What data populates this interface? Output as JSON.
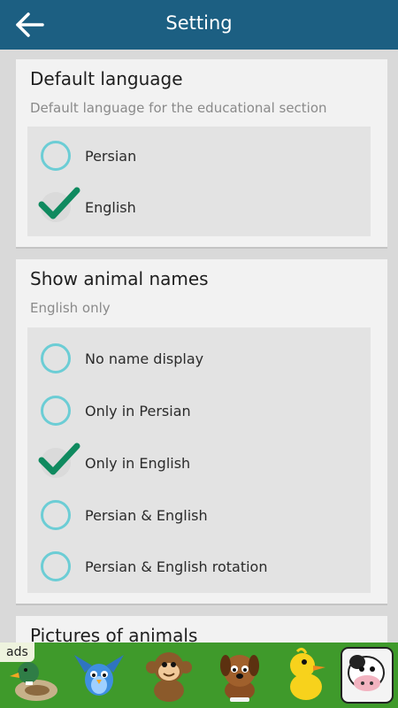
{
  "appbar": {
    "title": "Setting",
    "back_icon": "arrow-back-icon"
  },
  "language_section": {
    "title": "Default language",
    "subtitle": "Default language for the educational section",
    "options": [
      {
        "label": "Persian",
        "selected": false
      },
      {
        "label": "English",
        "selected": true
      }
    ]
  },
  "names_section": {
    "title": "Show animal names",
    "subtitle": "English only",
    "options": [
      {
        "label": "No name display",
        "selected": false
      },
      {
        "label": "Only in Persian",
        "selected": false
      },
      {
        "label": "Only in English",
        "selected": true
      },
      {
        "label": "Persian & English",
        "selected": false
      },
      {
        "label": "Persian & English rotation",
        "selected": false
      }
    ]
  },
  "pictures_section": {
    "title": "Pictures of animals"
  },
  "ad_banner": {
    "label": "ads",
    "animals": [
      "duck-icon",
      "blue-bird-icon",
      "monkey-icon",
      "puppy-icon",
      "duckling-icon",
      "cow-icon"
    ]
  },
  "colors": {
    "appbar": "#1c5f82",
    "radio_ring": "#6ccdd5",
    "check": "#0f8a5f",
    "ad_background": "#3f9a2b"
  }
}
